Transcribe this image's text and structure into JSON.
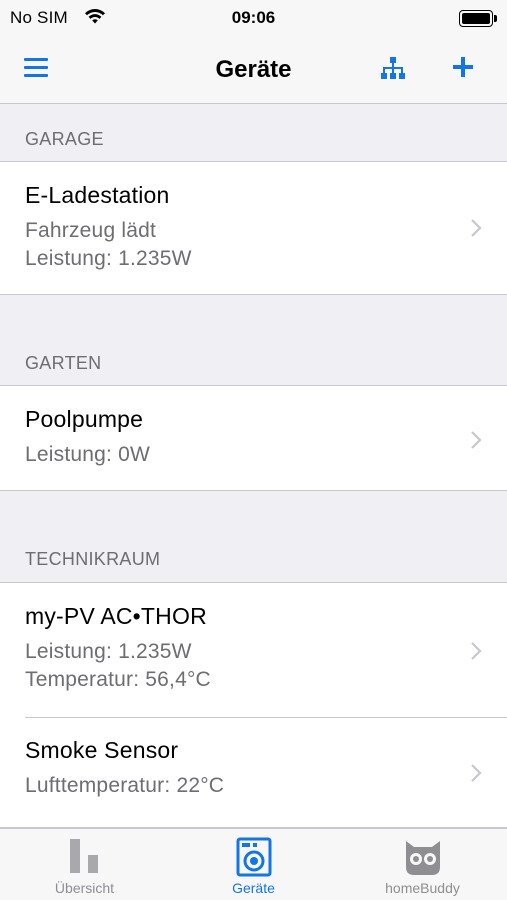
{
  "status_bar": {
    "carrier": "No SIM",
    "time": "09:06"
  },
  "nav": {
    "title": "Geräte",
    "menu_icon": "hamburger-icon",
    "tree_icon": "sitemap-icon",
    "add_icon": "plus-icon"
  },
  "sections": [
    {
      "header": "GARAGE",
      "rows": [
        {
          "title": "E-Ladestation",
          "lines": [
            "Fahrzeug lädt",
            "Leistung: 1.235W"
          ]
        }
      ]
    },
    {
      "header": "GARTEN",
      "rows": [
        {
          "title": "Poolpumpe",
          "lines": [
            "Leistung: 0W"
          ]
        }
      ]
    },
    {
      "header": "TECHNIKRAUM",
      "rows": [
        {
          "title": "my-PV AC•THOR",
          "lines": [
            "Leistung: 1.235W",
            "Temperatur: 56,4°C"
          ]
        },
        {
          "title": "Smoke Sensor",
          "lines": [
            "Lufttemperatur: 22°C"
          ]
        }
      ]
    }
  ],
  "tabs": [
    {
      "label": "Übersicht",
      "icon": "bar-chart-icon",
      "active": false
    },
    {
      "label": "Geräte",
      "icon": "washing-machine-icon",
      "active": true
    },
    {
      "label": "homeBuddy",
      "icon": "owl-icon",
      "active": false
    }
  ],
  "colors": {
    "accent": "#1475e5",
    "secondary_text": "#6d6d72",
    "tab_inactive": "#8e8e93",
    "background": "#efeff4"
  }
}
